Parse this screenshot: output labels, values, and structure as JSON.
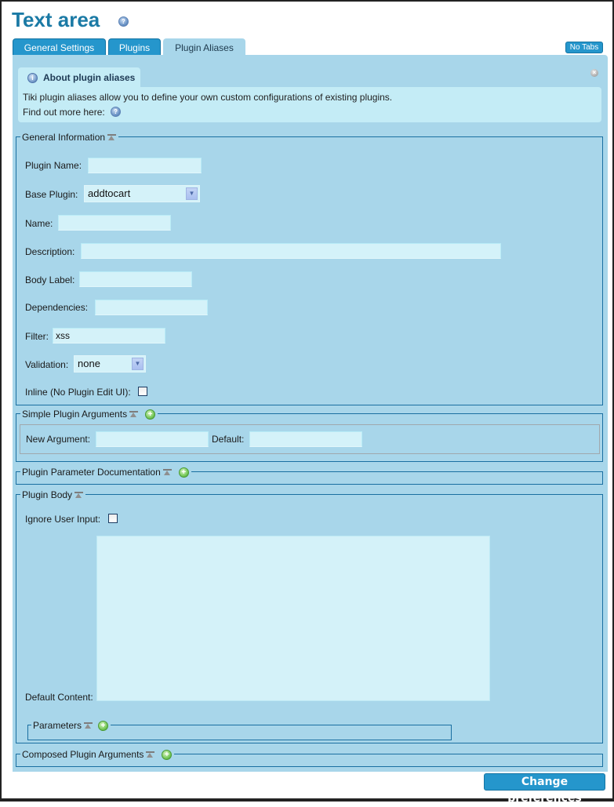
{
  "page": {
    "title": "Text area",
    "title_help_icon": "help-icon"
  },
  "tabs": [
    {
      "label": "General Settings",
      "active": false
    },
    {
      "label": "Plugins",
      "active": false
    },
    {
      "label": "Plugin Aliases",
      "active": true
    }
  ],
  "no_tabs_label": "No Tabs",
  "about": {
    "title": "About plugin aliases",
    "icon": "info-icon",
    "text": "Tiki plugin aliases allow you to define your own custom configurations of existing plugins.",
    "find_more": "Find out more here:",
    "close_icon": "close-icon"
  },
  "general_info": {
    "legend": "General Information",
    "fields": {
      "plugin_name": {
        "label": "Plugin Name:",
        "value": ""
      },
      "base_plugin": {
        "label": "Base Plugin:",
        "value": "addtocart"
      },
      "name": {
        "label": "Name:",
        "value": ""
      },
      "description": {
        "label": "Description:",
        "value": ""
      },
      "body_label": {
        "label": "Body Label:",
        "value": ""
      },
      "dependencies": {
        "label": "Dependencies:",
        "value": ""
      },
      "filter": {
        "label": "Filter:",
        "value": "xss"
      },
      "validation": {
        "label": "Validation:",
        "value": "none"
      },
      "inline": {
        "label": "Inline (No Plugin Edit UI):",
        "checked": false
      }
    }
  },
  "simple_args": {
    "legend": "Simple Plugin Arguments",
    "new_argument_label": "New Argument:",
    "new_argument_value": "",
    "default_label": "Default:",
    "default_value": ""
  },
  "param_doc": {
    "legend": "Plugin Parameter Documentation"
  },
  "plugin_body": {
    "legend": "Plugin Body",
    "ignore_user_input_label": "Ignore User Input:",
    "ignore_user_input_checked": false,
    "default_content_label": "Default Content:",
    "default_content_value": "",
    "parameters_legend": "Parameters"
  },
  "composed_args": {
    "legend": "Composed Plugin Arguments"
  },
  "submit_label": "Change preferences",
  "colors": {
    "accent": "#2596cc",
    "panel": "#a8d6ea",
    "title": "#1b7aa5",
    "input_bg": "#d4f2f9",
    "border": "#1a6fa1"
  }
}
